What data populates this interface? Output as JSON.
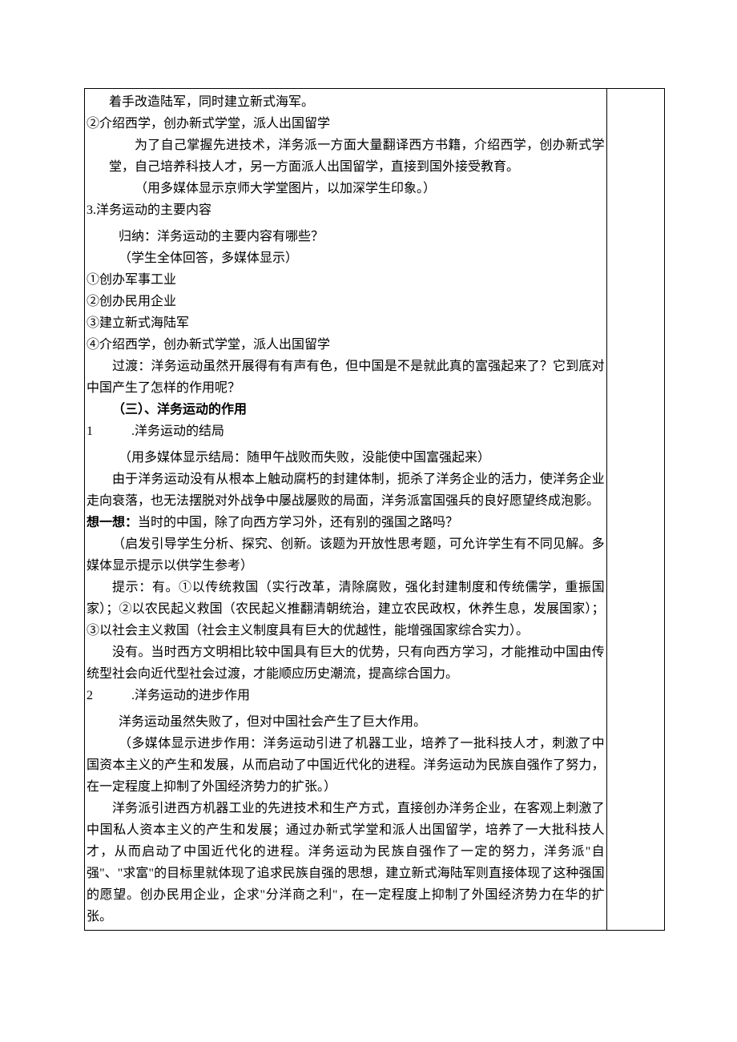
{
  "lines": {
    "l1": "着手改造陆军，同时建立新式海军。",
    "l2": "②介绍西学，创办新式学堂，派人出国留学",
    "l3": "为了自己掌握先进技术，洋务派一方面大量翻译西方书籍，介绍西学，创办新式学堂，自己培养科技人才，另一方面派人出国留学，直接到国外接受教育。",
    "l4": "（用多媒体显示京师大学堂图片，以加深学生印象。）",
    "l5": "3.洋务运动的主要内容",
    "l6": "归纳：洋务运动的主要内容有哪些？",
    "l7": "（学生全体回答，多媒体显示）",
    "l8": "①创办军事工业",
    "l9": "②创办民用企业",
    "l10": "③建立新式海陆军",
    "l11": "④介绍西学，创办新式学堂，派人出国留学",
    "l12": "过渡：洋务运动虽然开展得有有声有色，但中国是不是就此真的富强起来了？它到底对中国产生了怎样的作用呢？",
    "heading3": "（三）、洋务运动的作用",
    "n1_num": "1",
    "n1_text": ".洋务运动的结局",
    "l14": "（用多媒体显示结局：随甲午战败而失败，没能使中国富强起来）",
    "l15": "由于洋务运动没有从根本上触动腐朽的封建体制，扼杀了洋务企业的活力，使洋务企业走向衰落，也无法摆脱对外战争中屡战屡败的局面，洋务派富国强兵的良好愿望终成泡影。",
    "think_label": "想一想：",
    "think_text": "当时的中国，除了向西方学习外，还有别的强国之路吗？",
    "l17": "（启发引导学生分析、探究、创新。该题为开放性思考题，可允许学生有不同见解。多媒体显示提示以供学生参考）",
    "l18": "提示：有。①以传统救国（实行改革，清除腐败，强化封建制度和传统儒学，重振国家）；②以农民起义救国（农民起义推翻清朝统治，建立农民政权，休养生息，发展国家）；③以社会主义救国（社会主义制度具有巨大的优越性，能增强国家综合实力）。",
    "l19": "没有。当时西方文明相比较中国具有巨大的优势，只有向西方学习，才能推动中国由传统型社会向近代型社会过渡，才能顺应历史潮流，提高综合国力。",
    "n2_num": "2",
    "n2_text": ".洋务运动的进步作用",
    "l21": "洋务运动虽然失败了，但对中国社会产生了巨大作用。",
    "l22": "（多媒体显示进步作用：洋务运动引进了机器工业，培养了一批科技人才，刺激了中国资本主义的产生和发展，从而启动了中国近代化的进程。洋务运动为民族自强作了努力，在一定程度上抑制了外国经济势力的扩张。）",
    "l23": "洋务派引进西方机器工业的先进技术和生产方式，直接创办洋务企业，在客观上刺激了中国私人资本主义的产生和发展；通过办新式学堂和派人出国留学，培养了一大批科技人才，从而启动了中国近代化的进程。洋务运动为民族自强作了一定的努力，洋务派\"自强\"、\"求富\"的目标里就体现了追求民族自强的思想，建立新式海陆军则直接体现了这种强国的愿望。创办民用企业，企求\"分洋商之利\"，在一定程度上抑制了外国经济势力在华的扩张。"
  }
}
